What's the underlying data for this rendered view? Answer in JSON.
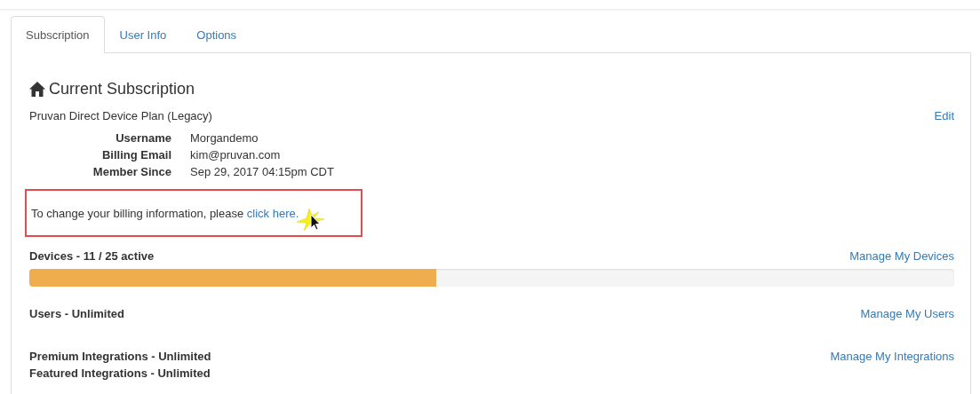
{
  "tabs": [
    {
      "label": "Subscription",
      "selected": true
    },
    {
      "label": "User Info",
      "selected": false
    },
    {
      "label": "Options",
      "selected": false
    }
  ],
  "subscription": {
    "title": "Current Subscription",
    "plan": "Pruvan Direct Device Plan (Legacy)",
    "edit_link": "Edit",
    "details": [
      {
        "label": "Username",
        "value": "Morgandemo"
      },
      {
        "label": "Billing Email",
        "value": "kim@pruvan.com"
      },
      {
        "label": "Member Since",
        "value": "Sep 29, 2017 04:15pm CDT"
      }
    ],
    "billing_note": {
      "text": "To change your billing information, please ",
      "link": "click here."
    },
    "devices": {
      "label": "Devices - 11 / 25 active",
      "link": "Manage My Devices",
      "level": 0.44
    },
    "users": {
      "label": "Users - Unlimited",
      "link": "Manage My Users"
    },
    "integrations": {
      "labels": [
        "Premium Integrations - Unlimited",
        "Featured Integrations - Unlimited"
      ],
      "link": "Manage My Integrations"
    }
  }
}
